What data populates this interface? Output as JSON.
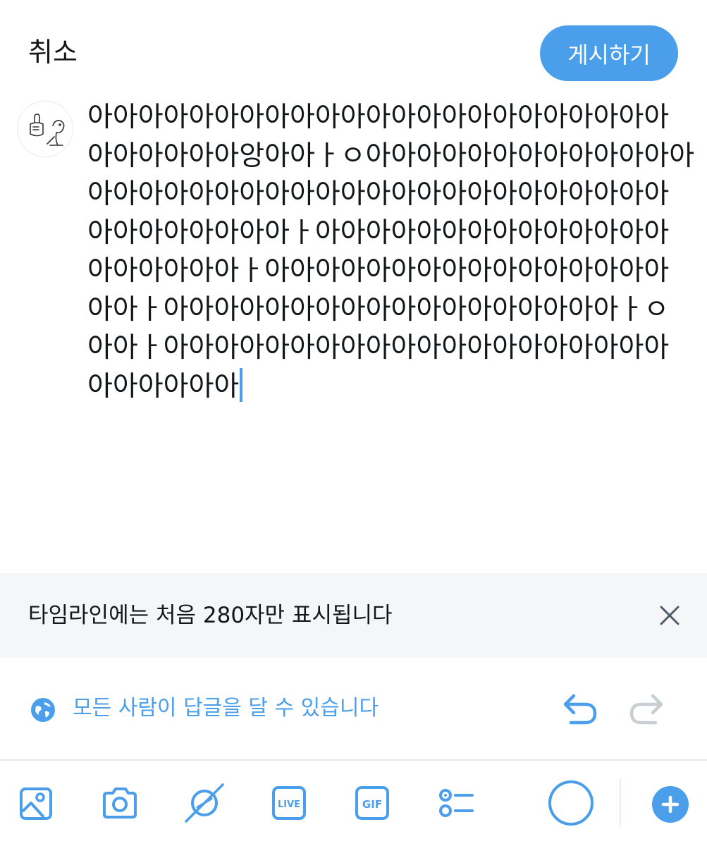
{
  "header": {
    "cancel_label": "취소",
    "post_label": "게시하기"
  },
  "compose": {
    "lines": [
      "아아아아아아아아아아아아아아아아아아아아아아아",
      "아아아아아아앙아아ㅏㅇ아아아아아아아아아아아아아",
      "아아아아아아아아아아아아아아아아아아아아아아아",
      "아아아아아아아아ㅏ아아아아아아아아아아아아아아",
      "아아아아아아ㅏ아아아아아아아아아아아아아아아아",
      "아아ㅏ아아아아아아아아아아아아아아아아아아ㅏㅇ",
      "아아ㅏ아아아아아아아아아아아아아아아아아아아아",
      "아아아아아아"
    ]
  },
  "notice": {
    "text": "타임라인에는 처음 280자만 표시됩니다"
  },
  "reply_settings": {
    "label": "모든 사람이 답글을 달 수 있습니다"
  },
  "colors": {
    "accent": "#4a9eea",
    "text": "#14171a",
    "notice_bg": "#f4f6f8",
    "disabled": "#c9ced3"
  },
  "toolbar": {
    "icons": [
      "image-icon",
      "camera-icon",
      "sparkle-icon",
      "live-icon",
      "gif-icon",
      "poll-icon"
    ],
    "live_label": "LIVE",
    "gif_label": "GIF"
  }
}
